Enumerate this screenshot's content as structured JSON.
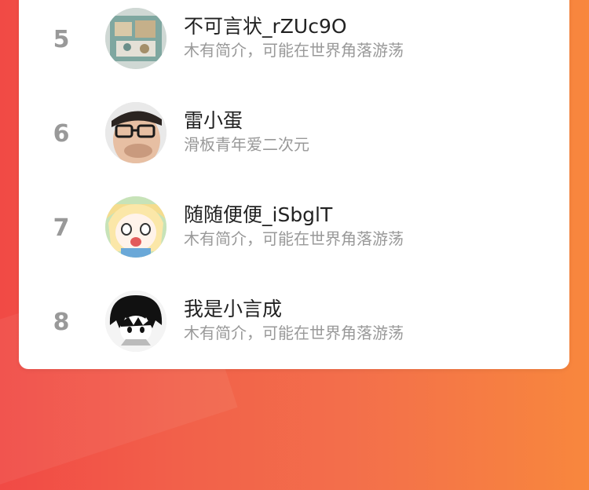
{
  "ranking": {
    "items": [
      {
        "rank": "5",
        "name": "不可言状_rZUc9O",
        "bio": "木有简介，可能在世界角落游荡",
        "avatar_icon": "photo-avatar-icon"
      },
      {
        "rank": "6",
        "name": "雷小蛋",
        "bio": "滑板青年爱二次元",
        "avatar_icon": "glasses-man-avatar-icon"
      },
      {
        "rank": "7",
        "name": "随随便便_iSbglT",
        "bio": "木有简介，可能在世界角落游荡",
        "avatar_icon": "anime-girl-avatar-icon"
      },
      {
        "rank": "8",
        "name": "我是小言成",
        "bio": "木有简介，可能在世界角落游荡",
        "avatar_icon": "anime-boy-avatar-icon"
      }
    ]
  },
  "colors": {
    "background_left": "#f14a45",
    "background_right": "#f8873d",
    "rank_text": "#999999",
    "name_text": "#222222",
    "bio_text": "#999999"
  }
}
